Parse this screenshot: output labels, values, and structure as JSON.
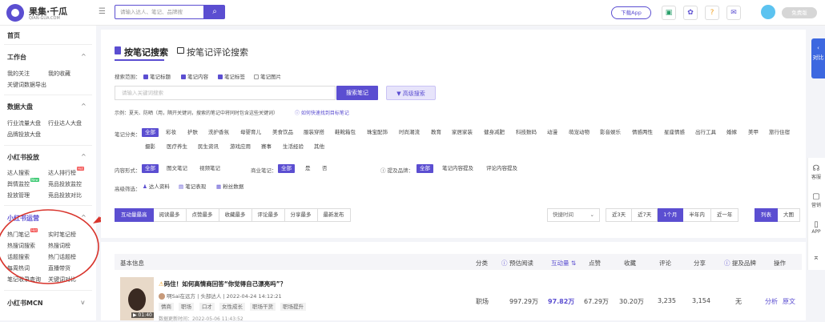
{
  "header": {
    "logo": "果集·千瓜",
    "logo_sub": "QIAN-GUA.COM",
    "search_placeholder": "请输入达人、笔记、品牌搜",
    "download": "下载App",
    "vip": "免费版"
  },
  "sidebar": {
    "home": "首页",
    "groups": [
      {
        "title": "工作台",
        "items": [
          "我的关注",
          "我的收藏",
          "关键词数据导出"
        ]
      },
      {
        "title": "数据大盘",
        "items": [
          "行业流量大盘",
          "行业达人大盘",
          "品牌投放大盘"
        ]
      },
      {
        "title": "小红书投放",
        "items": [
          "达人搜索",
          "达人排行榜",
          "舆情监控",
          "竞品投放监控",
          "投放管理",
          "竞品投放对比"
        ]
      },
      {
        "title": "小红书运营",
        "items": [
          "热门笔记",
          "实时笔记榜",
          "热搜词搜索",
          "热搜词榜",
          "话题搜索",
          "热门话题榜",
          "每周热词",
          "直播带货",
          "笔记收录查询",
          "关键词对比"
        ]
      },
      {
        "title": "小红书MCN",
        "items": []
      }
    ]
  },
  "tabs": {
    "note_search": "按笔记搜索",
    "comment_search": "按笔记评论搜索"
  },
  "scope": {
    "label": "搜索范围：",
    "options": [
      "笔记标题",
      "笔记内容",
      "笔记标签",
      "笔记图片"
    ]
  },
  "keyword_placeholder": "请输入关键词搜索",
  "search_btn": "搜索笔记",
  "advanced_btn": "高级搜索",
  "example": "示例：夏天、防晒（用，隔开关键词，搜索的笔记中将同时包含这些关键词）",
  "example_link": "如何快速找到目标笔记",
  "category": {
    "label": "笔记分类：",
    "items": [
      "全部",
      "彩妆",
      "护肤",
      "洗护香氛",
      "母婴育儿",
      "美食饮品",
      "服装穿搭",
      "鞋靴箱包",
      "珠宝配饰",
      "时尚潮流",
      "教育",
      "家居家装",
      "健身减肥",
      "科技数码",
      "动漫",
      "萌宠动物",
      "影音娱乐",
      "情感两性",
      "星座情感",
      "出行工具",
      "婚嫁",
      "美甲",
      "旅行住宿",
      "摄影",
      "医疗养生",
      "民生资讯",
      "游戏应用",
      "赛事",
      "生活经验",
      "其他"
    ]
  },
  "form": {
    "label": "内容形式：",
    "items": [
      "全部",
      "图文笔记",
      "视频笔记"
    ]
  },
  "commercial": {
    "label": "商业笔记：",
    "items": [
      "全部",
      "是",
      "否"
    ]
  },
  "brand": {
    "label": "提及品牌：",
    "items": [
      "全部",
      "笔记内容提及",
      "评论内容提及"
    ]
  },
  "advanced": {
    "label": "高级筛选：",
    "items": [
      "达人资料",
      "笔记表现",
      "粉丝数据"
    ]
  },
  "sort": [
    "互动量最高",
    "阅读最多",
    "点赞最多",
    "收藏最多",
    "评论最多",
    "分享最多",
    "最新发布"
  ],
  "quick_time": "快捷时间",
  "periods": [
    "近3天",
    "近7天",
    "1个月",
    "半年内",
    "近一年"
  ],
  "views": [
    "列表",
    "大图"
  ],
  "table_headers": [
    "基本信息",
    "分类",
    "预估阅读",
    "互动量",
    "点赞",
    "收藏",
    "评论",
    "分享",
    "提及品牌",
    "操作"
  ],
  "row": {
    "title": "码住！如何高情商回答“你觉得自己漂亮吗”？",
    "author": "啊Sai在远方",
    "level": "头部达人",
    "date": "2022-04-24 14:12:21",
    "tags": [
      "情商",
      "职场",
      "口才",
      "女性成长",
      "职场干货",
      "职场提升"
    ],
    "update": "数据更新时间：2022-05-06 11:43:52",
    "duration": "01:40",
    "category": "职场",
    "read": "997.29万",
    "interact": "97.82万",
    "like": "67.29万",
    "fav": "30.20万",
    "comment": "3,235",
    "share": "3,154",
    "brand": "无",
    "analyze": "分析",
    "original": "原文"
  },
  "right": {
    "compare": "对比",
    "service": "客服",
    "marketing": "营销",
    "app": "APP"
  }
}
